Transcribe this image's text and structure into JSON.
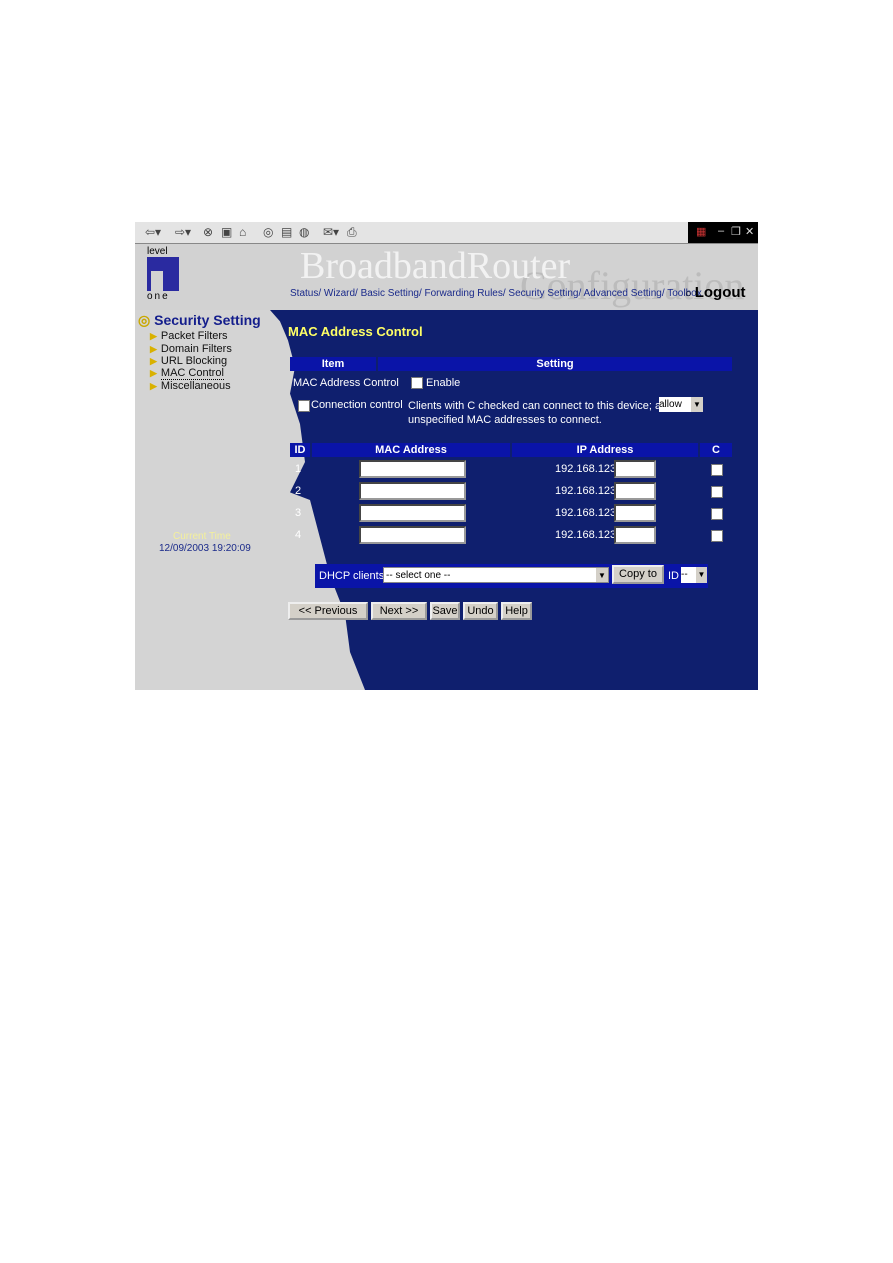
{
  "toolbar": {
    "icons": [
      "back-icon",
      "forward-icon",
      "stop-icon",
      "refresh-icon",
      "home-icon",
      "search-icon",
      "favorites-icon",
      "history-icon",
      "mail-icon",
      "print-icon"
    ],
    "window_controls": [
      "minimize-icon",
      "restore-icon",
      "close-icon"
    ]
  },
  "header": {
    "logo_top": "level",
    "logo_bottom": "one",
    "brand": "BroadbandRouter",
    "brand_sub": "Configuration",
    "nav": "Status/ Wizard/ Basic Setting/ Forwarding Rules/ Security Setting/ Advanced Setting/ Toolbox",
    "logout": "Logout"
  },
  "sidebar": {
    "title": "Security Setting",
    "items": [
      {
        "label": "Packet Filters"
      },
      {
        "label": "Domain Filters"
      },
      {
        "label": "URL Blocking"
      },
      {
        "label": "MAC Control",
        "active": true
      },
      {
        "label": "Miscellaneous"
      }
    ],
    "time_label": "Current Time",
    "time_value": "12/09/2003 19:20:09"
  },
  "main": {
    "title": "MAC Address Control",
    "col_item": "Item",
    "col_setting": "Setting",
    "row1_label": "MAC Address Control",
    "row1_enable": "Enable",
    "row2_label": "Connection control",
    "row2_text1": "Clients with C checked can connect to this device; and",
    "row2_select": "allow",
    "row2_text2": "unspecified MAC addresses to connect.",
    "table": {
      "headers": [
        "ID",
        "MAC Address",
        "IP Address",
        "C"
      ],
      "rows": [
        {
          "id": "1",
          "mac": "",
          "ip_prefix": "192.168.123.",
          "ip": ""
        },
        {
          "id": "2",
          "mac": "",
          "ip_prefix": "192.168.123.",
          "ip": ""
        },
        {
          "id": "3",
          "mac": "",
          "ip_prefix": "192.168.123.",
          "ip": ""
        },
        {
          "id": "4",
          "mac": "",
          "ip_prefix": "192.168.123.",
          "ip": ""
        }
      ]
    },
    "dhcp_label": "DHCP clients",
    "dhcp_select": "-- select one --",
    "copy_to": "Copy to",
    "id_label": "ID",
    "id_select": "--",
    "buttons": {
      "previous": "<< Previous",
      "next": "Next >>",
      "save": "Save",
      "undo": "Undo",
      "help": "Help"
    }
  }
}
